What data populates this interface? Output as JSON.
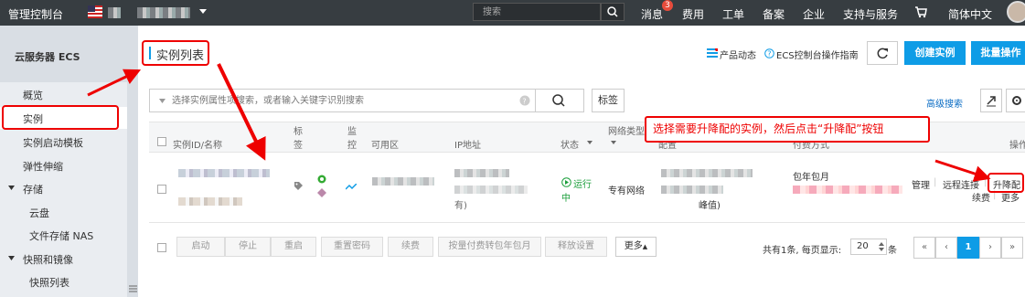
{
  "topbar": {
    "console_title": "管理控制台",
    "search_placeholder": "搜索",
    "messages": "消息",
    "message_count": "3",
    "billing": "费用",
    "tickets": "工单",
    "icp": "备案",
    "enterprise": "企业",
    "support": "支持与服务",
    "language": "简体中文"
  },
  "sidebar": {
    "title": "云服务器 ECS",
    "items": [
      {
        "label": "概览"
      },
      {
        "label": "实例"
      },
      {
        "label": "实例启动模板"
      },
      {
        "label": "弹性伸缩"
      },
      {
        "label": "存储"
      },
      {
        "label": "云盘"
      },
      {
        "label": "文件存储 NAS"
      },
      {
        "label": "快照和镜像"
      },
      {
        "label": "快照列表"
      }
    ]
  },
  "header": {
    "page_title": "实例列表",
    "product_news": "产品动态",
    "guide": "ECS控制台操作指南",
    "create_instance": "创建实例",
    "batch_ops": "批量操作"
  },
  "filter": {
    "placeholder": "选择实例属性项搜索，或者输入关键字识别搜索",
    "tag_button": "标签",
    "advanced_search": "高级搜索"
  },
  "table": {
    "headers": {
      "instance": "实例ID/名称",
      "tag1": "标",
      "tag2": "签",
      "monitor1": "监",
      "monitor2": "控",
      "zone": "可用区",
      "ip": "IP地址",
      "status": "状态",
      "network1": "网络类型",
      "config": "配置",
      "billing": "付费方式",
      "actions": "操作"
    },
    "row": {
      "ip_suffix": "有)",
      "status_line1": "运行",
      "status_line2": "中",
      "network": "专有网络",
      "config_suffix": "峰值)",
      "billing": "包年包月",
      "action_manage": "管理",
      "action_remote": "远程连接",
      "action_upgrade": "升降配",
      "action_renew": "续费",
      "action_more": "更多"
    }
  },
  "bottom": {
    "start": "启动",
    "stop": "停止",
    "restart": "重启",
    "reset_password": "重置密码",
    "renew": "续费",
    "convert": "按量付费转包年包月",
    "release": "释放设置",
    "more": "更多",
    "summary": "共有1条, 每页显示:",
    "page_size": "20",
    "page_unit": "条",
    "current_page": "1"
  },
  "annotation": {
    "text": "选择需要升降配的实例，然后点击“升降配”按钮"
  }
}
